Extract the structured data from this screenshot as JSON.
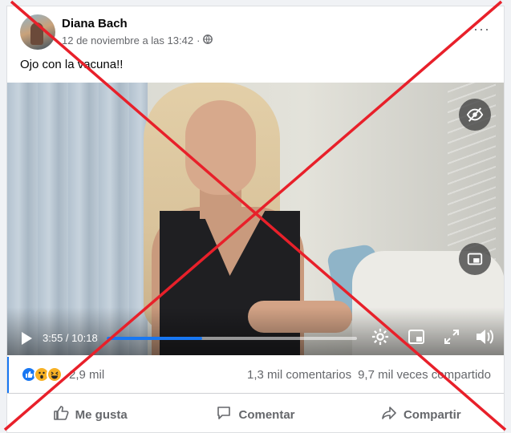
{
  "post": {
    "author": "Diana Bach",
    "timestamp": "12 de noviembre a las 13:42",
    "separator": "·",
    "audience_icon": "globe-icon",
    "more_icon": "more-options-icon",
    "more_label": "···",
    "text": "Ojo con la vacuna!!"
  },
  "video": {
    "current_time": "3:55 / 10:18",
    "progress": 0.38,
    "controls": [
      "play-icon",
      "settings-icon",
      "picture-in-picture-icon",
      "fullscreen-icon",
      "volume-icon"
    ],
    "overlay_buttons": [
      "hidden-eye-icon",
      "minimize-player-icon"
    ]
  },
  "stats": {
    "reactions": [
      "like",
      "wow",
      "haha"
    ],
    "reaction_count": "2,9 mil",
    "comments": "1,3 mil comentarios",
    "shares": "9,7 mil veces compartido"
  },
  "actions": {
    "like": "Me gusta",
    "comment": "Comentar",
    "share": "Compartir"
  },
  "colors": {
    "accent": "#1877f2",
    "cross": "#e8202a",
    "muted_text": "#65676b"
  }
}
